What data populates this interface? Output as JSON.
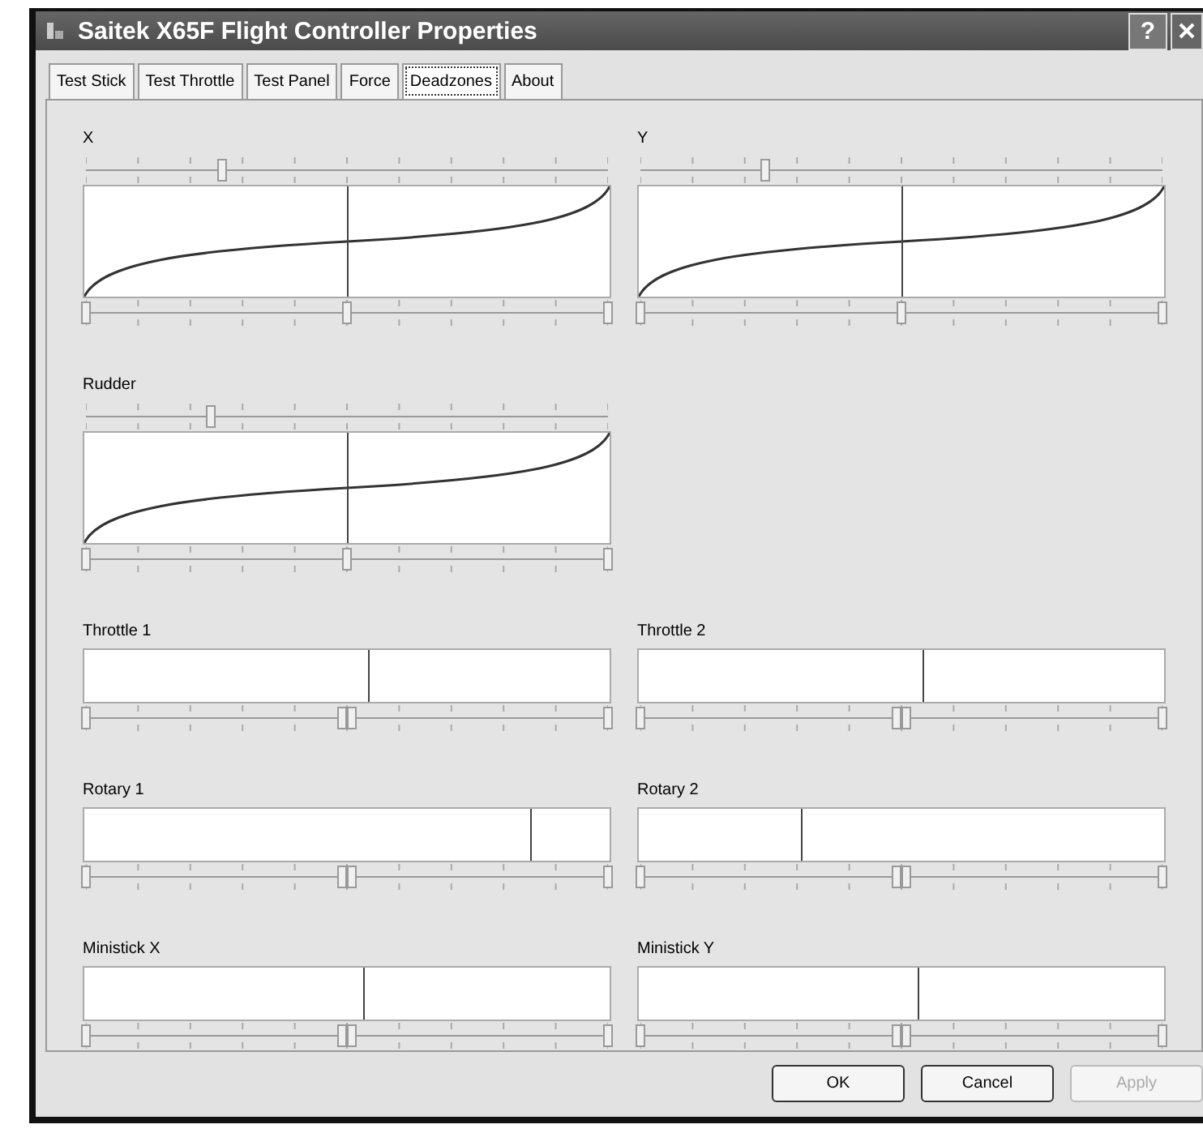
{
  "window": {
    "title": "Saitek X65F Flight Controller Properties",
    "help": "?"
  },
  "tabs": [
    {
      "label": "Test Stick",
      "selected": false
    },
    {
      "label": "Test Throttle",
      "selected": false
    },
    {
      "label": "Test Panel",
      "selected": false
    },
    {
      "label": "Force",
      "selected": false
    },
    {
      "label": "Deadzones",
      "selected": true
    },
    {
      "label": "About",
      "selected": false
    }
  ],
  "axes": [
    {
      "kind": "curve",
      "label": "X",
      "top_slider": {
        "level": 0.26
      },
      "position": {
        "level": 0.5
      },
      "thumbs": [
        {
          "level": 0
        },
        {
          "level": 0.5
        },
        {
          "level": 1
        }
      ]
    },
    {
      "kind": "curve",
      "label": "Y",
      "top_slider": {
        "level": 0.24
      },
      "position": {
        "level": 0.5
      },
      "thumbs": [
        {
          "level": 0
        },
        {
          "level": 0.5
        },
        {
          "level": 1
        }
      ]
    },
    {
      "kind": "curve",
      "label": "Rudder",
      "top_slider": {
        "level": 0.24
      },
      "position": {
        "level": 0.5
      },
      "thumbs": [
        {
          "level": 0
        },
        {
          "level": 0.5
        },
        {
          "level": 1
        }
      ]
    },
    {
      "kind": "empty"
    },
    {
      "kind": "bar",
      "label": "Throttle 1",
      "position": {
        "level": 0.54
      },
      "thumbs": [
        {
          "level": 0
        },
        {
          "level": 0.49
        },
        {
          "level": 0.51
        },
        {
          "level": 1
        }
      ]
    },
    {
      "kind": "bar",
      "label": "Throttle 2",
      "position": {
        "level": 0.54
      },
      "thumbs": [
        {
          "level": 0
        },
        {
          "level": 0.49
        },
        {
          "level": 0.51
        },
        {
          "level": 1
        }
      ]
    },
    {
      "kind": "bar",
      "label": "Rotary 1",
      "position": {
        "level": 0.85
      },
      "thumbs": [
        {
          "level": 0
        },
        {
          "level": 0.49
        },
        {
          "level": 0.51
        },
        {
          "level": 1
        }
      ]
    },
    {
      "kind": "bar",
      "label": "Rotary 2",
      "position": {
        "level": 0.31
      },
      "thumbs": [
        {
          "level": 0
        },
        {
          "level": 0.49
        },
        {
          "level": 0.51
        },
        {
          "level": 1
        }
      ]
    },
    {
      "kind": "bar",
      "label": "Ministick X",
      "position": {
        "level": 0.53
      },
      "thumbs": [
        {
          "level": 0
        },
        {
          "level": 0.49
        },
        {
          "level": 0.51
        },
        {
          "level": 1
        }
      ]
    },
    {
      "kind": "bar",
      "label": "Ministick Y",
      "position": {
        "level": 0.53
      },
      "thumbs": [
        {
          "level": 0
        },
        {
          "level": 0.49
        },
        {
          "level": 0.51
        },
        {
          "level": 1
        }
      ]
    }
  ],
  "buttons": [
    {
      "label": "OK",
      "disabled": false
    },
    {
      "label": "Cancel",
      "disabled": false
    },
    {
      "label": "Apply",
      "disabled": true
    }
  ]
}
